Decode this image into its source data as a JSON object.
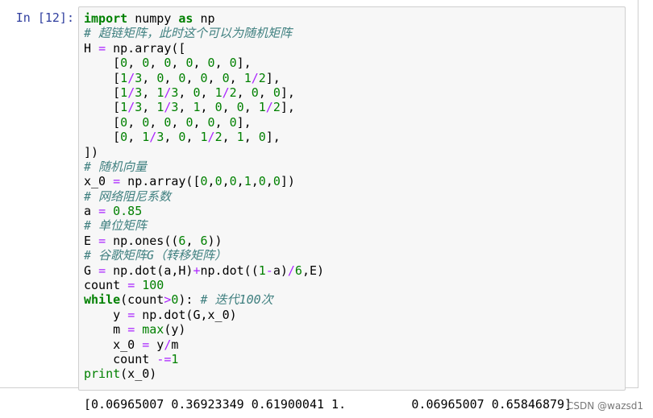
{
  "cell": {
    "prompt": "In [12]:",
    "lines": [
      [
        [
          "kw",
          "import"
        ],
        [
          "t",
          " numpy "
        ],
        [
          "kw",
          "as"
        ],
        [
          "t",
          " np"
        ]
      ],
      [
        [
          "cm",
          "# 超链矩阵，此时这个可以为随机矩阵"
        ]
      ],
      [
        [
          "t",
          "H "
        ],
        [
          "op",
          "="
        ],
        [
          "t",
          " np.array(["
        ]
      ],
      [
        [
          "t",
          "    ["
        ],
        [
          "num",
          "0"
        ],
        [
          "t",
          ", "
        ],
        [
          "num",
          "0"
        ],
        [
          "t",
          ", "
        ],
        [
          "num",
          "0"
        ],
        [
          "t",
          ", "
        ],
        [
          "num",
          "0"
        ],
        [
          "t",
          ", "
        ],
        [
          "num",
          "0"
        ],
        [
          "t",
          ", "
        ],
        [
          "num",
          "0"
        ],
        [
          "t",
          "],"
        ]
      ],
      [
        [
          "t",
          "    ["
        ],
        [
          "num",
          "1"
        ],
        [
          "op",
          "/"
        ],
        [
          "num",
          "3"
        ],
        [
          "t",
          ", "
        ],
        [
          "num",
          "0"
        ],
        [
          "t",
          ", "
        ],
        [
          "num",
          "0"
        ],
        [
          "t",
          ", "
        ],
        [
          "num",
          "0"
        ],
        [
          "t",
          ", "
        ],
        [
          "num",
          "0"
        ],
        [
          "t",
          ", "
        ],
        [
          "num",
          "1"
        ],
        [
          "op",
          "/"
        ],
        [
          "num",
          "2"
        ],
        [
          "t",
          "],"
        ]
      ],
      [
        [
          "t",
          "    ["
        ],
        [
          "num",
          "1"
        ],
        [
          "op",
          "/"
        ],
        [
          "num",
          "3"
        ],
        [
          "t",
          ", "
        ],
        [
          "num",
          "1"
        ],
        [
          "op",
          "/"
        ],
        [
          "num",
          "3"
        ],
        [
          "t",
          ", "
        ],
        [
          "num",
          "0"
        ],
        [
          "t",
          ", "
        ],
        [
          "num",
          "1"
        ],
        [
          "op",
          "/"
        ],
        [
          "num",
          "2"
        ],
        [
          "t",
          ", "
        ],
        [
          "num",
          "0"
        ],
        [
          "t",
          ", "
        ],
        [
          "num",
          "0"
        ],
        [
          "t",
          "],"
        ]
      ],
      [
        [
          "t",
          "    ["
        ],
        [
          "num",
          "1"
        ],
        [
          "op",
          "/"
        ],
        [
          "num",
          "3"
        ],
        [
          "t",
          ", "
        ],
        [
          "num",
          "1"
        ],
        [
          "op",
          "/"
        ],
        [
          "num",
          "3"
        ],
        [
          "t",
          ", "
        ],
        [
          "num",
          "1"
        ],
        [
          "t",
          ", "
        ],
        [
          "num",
          "0"
        ],
        [
          "t",
          ", "
        ],
        [
          "num",
          "0"
        ],
        [
          "t",
          ", "
        ],
        [
          "num",
          "1"
        ],
        [
          "op",
          "/"
        ],
        [
          "num",
          "2"
        ],
        [
          "t",
          "],"
        ]
      ],
      [
        [
          "t",
          "    ["
        ],
        [
          "num",
          "0"
        ],
        [
          "t",
          ", "
        ],
        [
          "num",
          "0"
        ],
        [
          "t",
          ", "
        ],
        [
          "num",
          "0"
        ],
        [
          "t",
          ", "
        ],
        [
          "num",
          "0"
        ],
        [
          "t",
          ", "
        ],
        [
          "num",
          "0"
        ],
        [
          "t",
          ", "
        ],
        [
          "num",
          "0"
        ],
        [
          "t",
          "],"
        ]
      ],
      [
        [
          "t",
          "    ["
        ],
        [
          "num",
          "0"
        ],
        [
          "t",
          ", "
        ],
        [
          "num",
          "1"
        ],
        [
          "op",
          "/"
        ],
        [
          "num",
          "3"
        ],
        [
          "t",
          ", "
        ],
        [
          "num",
          "0"
        ],
        [
          "t",
          ", "
        ],
        [
          "num",
          "1"
        ],
        [
          "op",
          "/"
        ],
        [
          "num",
          "2"
        ],
        [
          "t",
          ", "
        ],
        [
          "num",
          "1"
        ],
        [
          "t",
          ", "
        ],
        [
          "num",
          "0"
        ],
        [
          "t",
          "],"
        ]
      ],
      [
        [
          "t",
          "])"
        ]
      ],
      [
        [
          "cm",
          "# 随机向量"
        ]
      ],
      [
        [
          "t",
          "x_0 "
        ],
        [
          "op",
          "="
        ],
        [
          "t",
          " np.array(["
        ],
        [
          "num",
          "0"
        ],
        [
          "t",
          ","
        ],
        [
          "num",
          "0"
        ],
        [
          "t",
          ","
        ],
        [
          "num",
          "0"
        ],
        [
          "t",
          ","
        ],
        [
          "num",
          "1"
        ],
        [
          "t",
          ","
        ],
        [
          "num",
          "0"
        ],
        [
          "t",
          ","
        ],
        [
          "num",
          "0"
        ],
        [
          "t",
          "])"
        ]
      ],
      [
        [
          "cm",
          "# 网络阻尼系数"
        ]
      ],
      [
        [
          "t",
          "a "
        ],
        [
          "op",
          "="
        ],
        [
          "t",
          " "
        ],
        [
          "num",
          "0.85"
        ]
      ],
      [
        [
          "cm",
          "# 单位矩阵"
        ]
      ],
      [
        [
          "t",
          "E "
        ],
        [
          "op",
          "="
        ],
        [
          "t",
          " np.ones(("
        ],
        [
          "num",
          "6"
        ],
        [
          "t",
          ", "
        ],
        [
          "num",
          "6"
        ],
        [
          "t",
          "))"
        ]
      ],
      [
        [
          "cm",
          "# 谷歌矩阵G（转移矩阵）"
        ]
      ],
      [
        [
          "t",
          "G "
        ],
        [
          "op",
          "="
        ],
        [
          "t",
          " np.dot(a,H)"
        ],
        [
          "op",
          "+"
        ],
        [
          "t",
          "np.dot(("
        ],
        [
          "num",
          "1"
        ],
        [
          "op",
          "-"
        ],
        [
          "t",
          "a)"
        ],
        [
          "op",
          "/"
        ],
        [
          "num",
          "6"
        ],
        [
          "t",
          ",E)"
        ]
      ],
      [
        [
          "t",
          "count "
        ],
        [
          "op",
          "="
        ],
        [
          "t",
          " "
        ],
        [
          "num",
          "100"
        ]
      ],
      [
        [
          "kw",
          "while"
        ],
        [
          "t",
          "(count"
        ],
        [
          "op",
          ">"
        ],
        [
          "num",
          "0"
        ],
        [
          "t",
          "): "
        ],
        [
          "cm",
          "# 迭代100次"
        ]
      ],
      [
        [
          "t",
          "    y "
        ],
        [
          "op",
          "="
        ],
        [
          "t",
          " np.dot(G,x_0)"
        ]
      ],
      [
        [
          "t",
          "    m "
        ],
        [
          "op",
          "="
        ],
        [
          "t",
          " "
        ],
        [
          "fn",
          "max"
        ],
        [
          "t",
          "(y)"
        ]
      ],
      [
        [
          "t",
          "    x_0 "
        ],
        [
          "op",
          "="
        ],
        [
          "t",
          " y"
        ],
        [
          "op",
          "/"
        ],
        [
          "t",
          "m"
        ]
      ],
      [
        [
          "t",
          "    count "
        ],
        [
          "op",
          "-="
        ],
        [
          "num",
          "1"
        ]
      ],
      [
        [
          "fn",
          "print"
        ],
        [
          "t",
          "(x_0)"
        ]
      ]
    ]
  },
  "output": {
    "text": "[0.06965007 0.36923349 0.61900041 1.         0.06965007 0.65846879]"
  },
  "watermark": "CSDN @wazsd1"
}
